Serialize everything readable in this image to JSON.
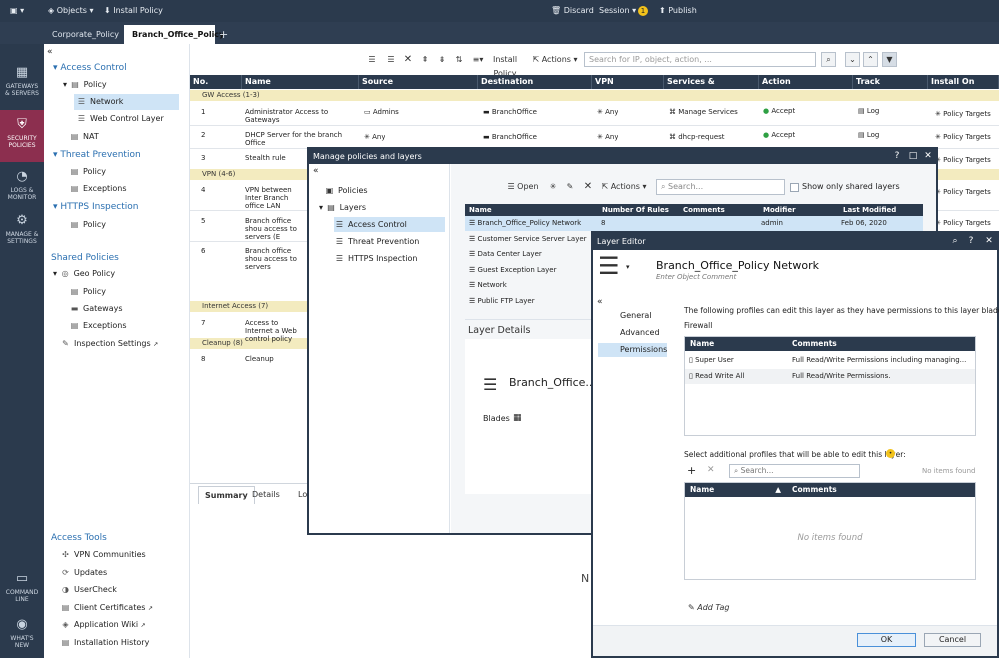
{
  "topbar": {
    "menu_label": "",
    "objects": "Objects",
    "install_policy": "Install Policy",
    "discard": "Discard",
    "session": "Session",
    "session_badge": "1",
    "publish": "Publish"
  },
  "tabs": [
    "Corporate_Policy",
    "Branch_Office_Policy"
  ],
  "nav": [
    {
      "line1": "GATEWAYS",
      "line2": "& SERVERS"
    },
    {
      "line1": "SECURITY",
      "line2": "POLICIES"
    },
    {
      "line1": "LOGS &",
      "line2": "MONITOR"
    },
    {
      "line1": "MANAGE &",
      "line2": "SETTINGS"
    },
    {
      "line1": "COMMAND",
      "line2": "LINE"
    },
    {
      "line1": "WHAT'S",
      "line2": "NEW"
    }
  ],
  "tree": {
    "collapse": "«",
    "access_control": "Access Control",
    "policy": "Policy",
    "network": "Network",
    "web_control_layer": "Web Control Layer",
    "nat": "NAT",
    "threat_prevention": "Threat Prevention",
    "tp_policy": "Policy",
    "tp_exceptions": "Exceptions",
    "https_inspection": "HTTPS Inspection",
    "https_policy": "Policy",
    "shared_policies": "Shared Policies",
    "geo_policy": "Geo Policy",
    "geo_policy_item": "Policy",
    "geo_gateways": "Gateways",
    "geo_exceptions": "Exceptions",
    "inspection_settings": "Inspection Settings",
    "access_tools": "Access Tools",
    "tools": [
      "VPN Communities",
      "Updates",
      "UserCheck",
      "Client Certificates",
      "Application Wiki",
      "Installation History"
    ]
  },
  "toolbar": {
    "install_policy": "Install Policy",
    "actions": "Actions",
    "search_placeholder": "Search for IP, object, action, ..."
  },
  "table": {
    "headers": [
      "No.",
      "Name",
      "Source",
      "Destination",
      "VPN",
      "Services & Applications",
      "Action",
      "Track",
      "Install On"
    ],
    "sections": [
      "GW Access (1-3)",
      "VPN (4-6)",
      "Internet Access (7)",
      "Cleanup (8)"
    ],
    "rows": [
      {
        "no": "1",
        "name": "Administrator Access to Gateways",
        "source": "Admins",
        "destination": "BranchOffice",
        "vpn": "Any",
        "service": "Manage Services",
        "action": "Accept",
        "track": "Log",
        "install": "Policy Targets"
      },
      {
        "no": "2",
        "name": "DHCP Server for the branch Office",
        "source": "Any",
        "destination": "BranchOffice",
        "vpn": "Any",
        "service": "dhcp-request",
        "action": "Accept",
        "track": "Log",
        "install": "Policy Targets"
      },
      {
        "no": "3",
        "name": "Stealth rule",
        "install": "Policy Targets"
      },
      {
        "no": "4",
        "name": "VPN between Inter Branch office LAN",
        "install": "Policy Targets"
      },
      {
        "no": "5",
        "name": "Branch office shou access to servers (E",
        "install": "Policy Targets"
      },
      {
        "no": "6",
        "name": "Branch office shou access to servers"
      },
      {
        "no": "7",
        "name": "Access to Internet a Web control policy"
      },
      {
        "no": "8",
        "name": "Cleanup"
      }
    ]
  },
  "bottom": {
    "tabs": [
      "Summary",
      "Details",
      "Lo"
    ],
    "partial_text": "N"
  },
  "manage": {
    "title": "Manage policies and layers",
    "collapse": "«",
    "tree": [
      "Policies",
      "Layers",
      "Access Control",
      "Threat Prevention",
      "HTTPS Inspection"
    ],
    "toolbar": {
      "open": "Open",
      "actions": "Actions",
      "search": "Search...",
      "show_shared": "Show only shared layers"
    },
    "headers": [
      "Name",
      "Number Of Rules",
      "Comments",
      "Modifier",
      "Last Modified"
    ],
    "layers": [
      {
        "name": "Branch_Office_Policy Network",
        "rules": "8",
        "modifier": "admin",
        "modified": "Feb 06, 2020"
      },
      {
        "name": "Customer Service Server Layer"
      },
      {
        "name": "Data Center Layer"
      },
      {
        "name": "Guest Exception Layer"
      },
      {
        "name": "Network"
      },
      {
        "name": "Public FTP Layer"
      }
    ],
    "details_title": "Layer Details",
    "details_name": "Branch_Office...",
    "blades_label": "Blades"
  },
  "editor": {
    "title": "Layer Editor",
    "name": "Branch_Office_Policy Network",
    "comment_placeholder": "Enter Object Comment",
    "collapse": "«",
    "nav": [
      "General",
      "Advanced",
      "Permissions"
    ],
    "intro": "The following profiles can edit this layer as they have permissions to this layer blades:",
    "blade": "Firewall",
    "perm_headers": [
      "Name",
      "Comments"
    ],
    "perm_rows": [
      {
        "name": "Super User",
        "comment": "Full Read/Write Permissions including managing..."
      },
      {
        "name": "Read Write All",
        "comment": "Full Read/Write Permissions."
      }
    ],
    "select_label": "Select additional profiles that will be able to edit this layer:",
    "search": "Search...",
    "no_items": "No items found",
    "add_headers": [
      "Name",
      "Comments"
    ],
    "no_items_found": "No items found",
    "add_tag": "Add Tag",
    "ok": "OK",
    "cancel": "Cancel"
  },
  "colors": {
    "dark_navy": "#2b3a4d",
    "active_nav": "#8c2f4f",
    "accent_blue": "#2a6fb0",
    "section_yellow": "#f3ebbf",
    "selection": "#cfe4f6"
  }
}
